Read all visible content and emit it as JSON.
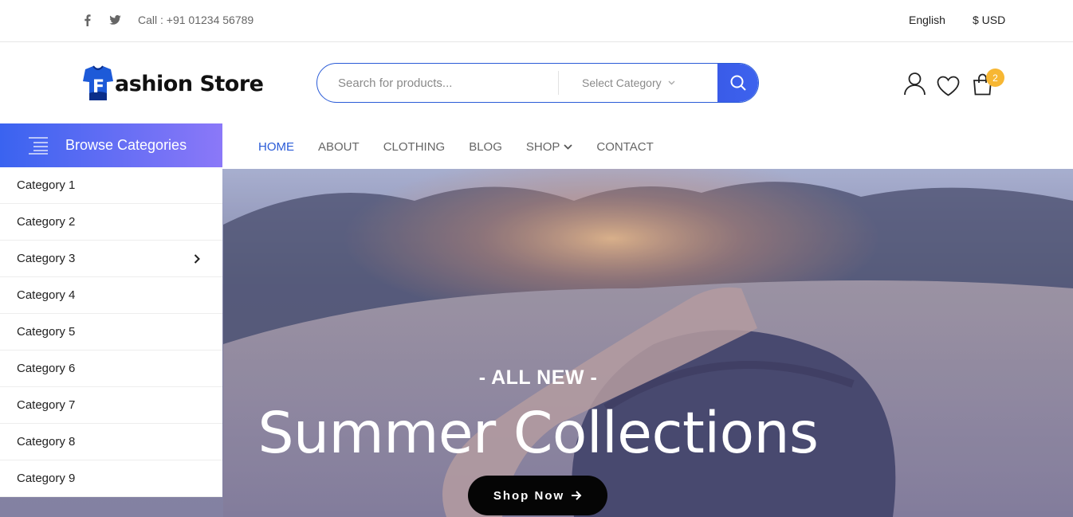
{
  "topbar": {
    "social": [
      "facebook-icon",
      "twitter-icon"
    ],
    "phone": "Call : +91 01234 56789",
    "language": "English",
    "currency": "$ USD"
  },
  "header": {
    "logo_letter": "F",
    "logo_text": "ashion Store",
    "search_placeholder": "Search for products...",
    "category_select": "Select Category",
    "cart_count": "2",
    "icons": [
      "user-icon",
      "heart-icon",
      "cart-icon"
    ]
  },
  "nav": {
    "browse_label": "Browse Categories",
    "items": [
      "HOME",
      "ABOUT",
      "CLOTHING",
      "BLOG",
      "SHOP",
      "CONTACT"
    ],
    "active": "HOME"
  },
  "categories": [
    "Category 1",
    "Category 2",
    "Category 3",
    "Category 4",
    "Category 5",
    "Category 6",
    "Category 7",
    "Category 8",
    "Category 9"
  ],
  "hero": {
    "tagline": "- ALL NEW -",
    "title": "Summer Collections",
    "button": "Shop Now"
  },
  "colors": {
    "accent": "#2a5bd7",
    "browse_gradient_start": "#3a63f0",
    "browse_gradient_end": "#8b78f8",
    "badge": "#f7b733"
  }
}
